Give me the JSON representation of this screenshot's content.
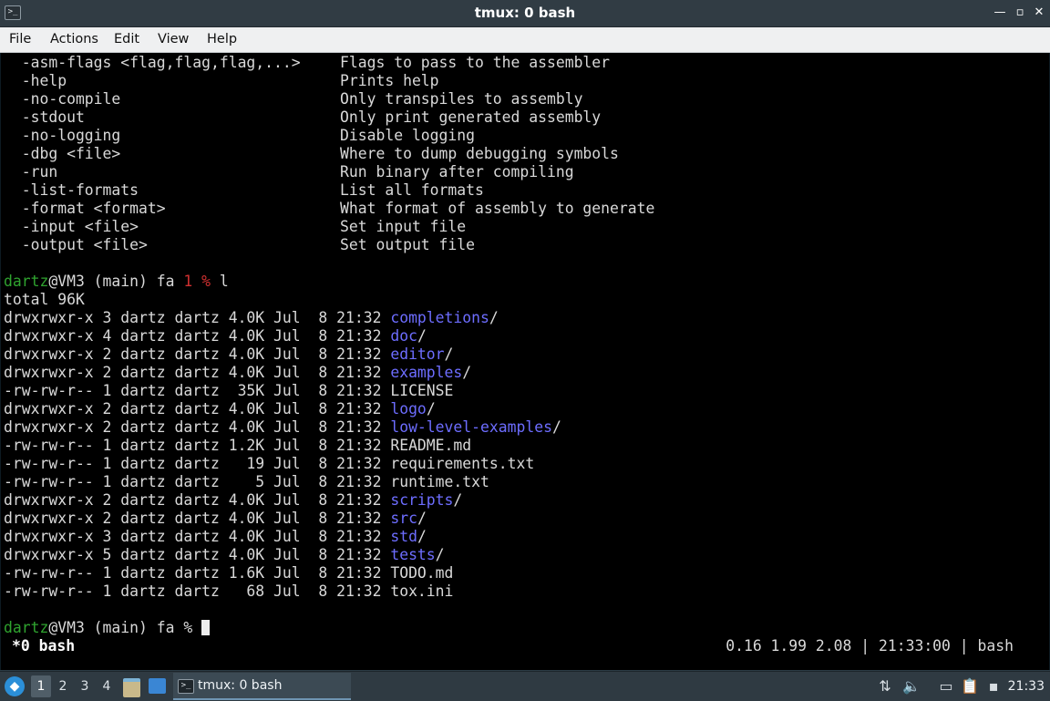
{
  "window": {
    "title": "tmux: 0 bash",
    "icon": "terminal-icon",
    "controls": {
      "minimize": "—",
      "restore": "▫",
      "close": "✕"
    }
  },
  "menu": [
    "File",
    "Actions",
    "Edit",
    "View",
    "Help"
  ],
  "terminal": {
    "help_lines": [
      {
        "flag": "  -asm-flags <flag,flag,flag,...>",
        "desc": "Flags to pass to the assembler"
      },
      {
        "flag": "  -help",
        "desc": "Prints help"
      },
      {
        "flag": "  -no-compile",
        "desc": "Only transpiles to assembly"
      },
      {
        "flag": "  -stdout",
        "desc": "Only print generated assembly"
      },
      {
        "flag": "  -no-logging",
        "desc": "Disable logging"
      },
      {
        "flag": "  -dbg <file>",
        "desc": "Where to dump debugging symbols"
      },
      {
        "flag": "  -run",
        "desc": "Run binary after compiling"
      },
      {
        "flag": "  -list-formats",
        "desc": "List all formats"
      },
      {
        "flag": "  -format <format>",
        "desc": "What format of assembly to generate"
      },
      {
        "flag": "  -input <file>",
        "desc": "Set input file"
      },
      {
        "flag": "  -output <file>",
        "desc": "Set output file"
      }
    ],
    "prompt1": {
      "user": "dartz",
      "host": "@VM3 (main) fa ",
      "status": "1 %",
      "command": " l"
    },
    "total": "total 96K",
    "listing": [
      {
        "meta": "drwxrwxr-x 3 dartz dartz 4.0K Jul  8 21:32 ",
        "name": "completions",
        "dir": true
      },
      {
        "meta": "drwxrwxr-x 4 dartz dartz 4.0K Jul  8 21:32 ",
        "name": "doc",
        "dir": true
      },
      {
        "meta": "drwxrwxr-x 2 dartz dartz 4.0K Jul  8 21:32 ",
        "name": "editor",
        "dir": true
      },
      {
        "meta": "drwxrwxr-x 2 dartz dartz 4.0K Jul  8 21:32 ",
        "name": "examples",
        "dir": true
      },
      {
        "meta": "-rw-rw-r-- 1 dartz dartz  35K Jul  8 21:32 ",
        "name": "LICENSE",
        "dir": false
      },
      {
        "meta": "drwxrwxr-x 2 dartz dartz 4.0K Jul  8 21:32 ",
        "name": "logo",
        "dir": true
      },
      {
        "meta": "drwxrwxr-x 2 dartz dartz 4.0K Jul  8 21:32 ",
        "name": "low-level-examples",
        "dir": true
      },
      {
        "meta": "-rw-rw-r-- 1 dartz dartz 1.2K Jul  8 21:32 ",
        "name": "README.md",
        "dir": false
      },
      {
        "meta": "-rw-rw-r-- 1 dartz dartz   19 Jul  8 21:32 ",
        "name": "requirements.txt",
        "dir": false
      },
      {
        "meta": "-rw-rw-r-- 1 dartz dartz    5 Jul  8 21:32 ",
        "name": "runtime.txt",
        "dir": false
      },
      {
        "meta": "drwxrwxr-x 2 dartz dartz 4.0K Jul  8 21:32 ",
        "name": "scripts",
        "dir": true
      },
      {
        "meta": "drwxrwxr-x 2 dartz dartz 4.0K Jul  8 21:32 ",
        "name": "src",
        "dir": true
      },
      {
        "meta": "drwxrwxr-x 3 dartz dartz 4.0K Jul  8 21:32 ",
        "name": "std",
        "dir": true
      },
      {
        "meta": "drwxrwxr-x 5 dartz dartz 4.0K Jul  8 21:32 ",
        "name": "tests",
        "dir": true
      },
      {
        "meta": "-rw-rw-r-- 1 dartz dartz 1.6K Jul  8 21:32 ",
        "name": "TODO.md",
        "dir": false
      },
      {
        "meta": "-rw-rw-r-- 1 dartz dartz   68 Jul  8 21:32 ",
        "name": "tox.ini",
        "dir": false
      }
    ],
    "prompt2": {
      "user": "dartz",
      "host": "@VM3 (main) fa ",
      "status": "% "
    },
    "tmux_status": {
      "window": "*0 bash",
      "right": "0.16 1.99 2.08 | 21:33:00 | bash"
    }
  },
  "taskbar": {
    "start_icon": "start-menu-icon",
    "workspaces": [
      "1",
      "2",
      "3",
      "4"
    ],
    "active_workspace": "1",
    "quicklaunch": [
      "file-manager-icon",
      "show-desktop-icon"
    ],
    "task_label": "tmux: 0 bash",
    "tray_icons": [
      "network-updown-icon",
      "volume-icon",
      "network-icon",
      "clipboard-icon",
      "notification-icon"
    ],
    "clock": "21:33"
  },
  "colors": {
    "prompt_user": "#2fa32f",
    "prompt_status": "#d03030",
    "directory": "#6d6dff",
    "terminal_bg": "#000000"
  }
}
